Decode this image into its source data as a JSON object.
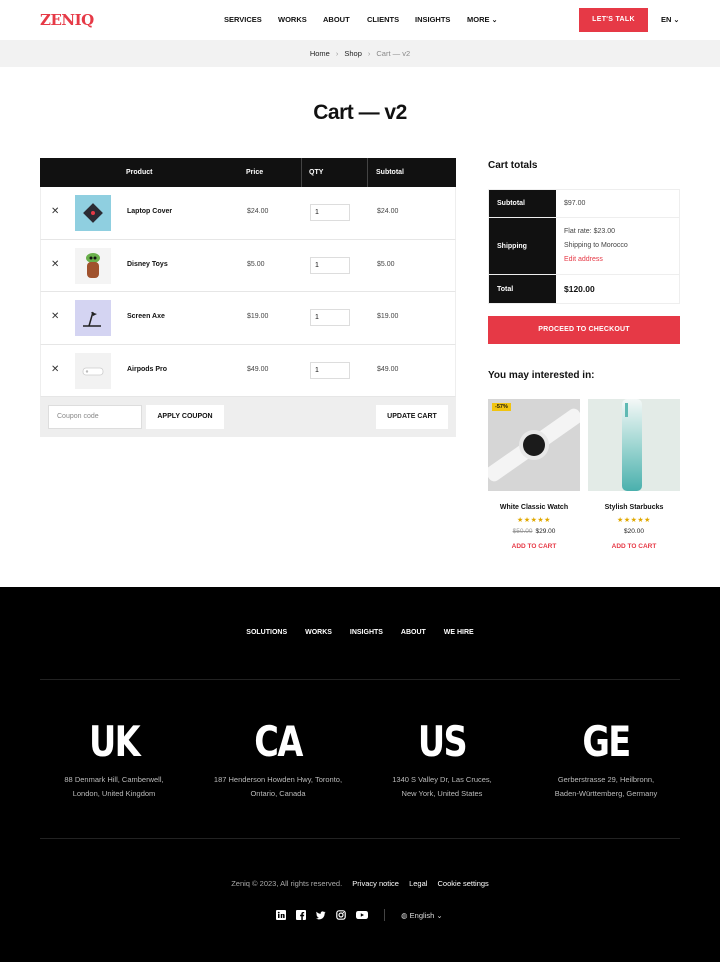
{
  "header": {
    "logo": "ZENIQ",
    "nav": [
      "SERVICES",
      "WORKS",
      "ABOUT",
      "CLIENTS",
      "INSIGHTS",
      "MORE"
    ],
    "cta": "LET'S TALK",
    "language": "EN"
  },
  "breadcrumb": [
    "Home",
    "Shop",
    "Cart — v2"
  ],
  "page_title": "Cart — v2",
  "cart": {
    "columns": [
      "Product",
      "Price",
      "QTY",
      "Subtotal"
    ],
    "rows": [
      {
        "name": "Laptop Cover",
        "price": "$24.00",
        "qty": "1",
        "subtotal": "$24.00"
      },
      {
        "name": "Disney Toys",
        "price": "$5.00",
        "qty": "1",
        "subtotal": "$5.00"
      },
      {
        "name": "Screen Axe",
        "price": "$19.00",
        "qty": "1",
        "subtotal": "$19.00"
      },
      {
        "name": "Airpods Pro",
        "price": "$49.00",
        "qty": "1",
        "subtotal": "$49.00"
      }
    ],
    "coupon_placeholder": "Coupon code",
    "apply_coupon": "APPLY COUPON",
    "update_cart": "UPDATE CART"
  },
  "totals": {
    "title": "Cart totals",
    "subtotal_label": "Subtotal",
    "subtotal": "$97.00",
    "shipping_label": "Shipping",
    "shipping_rate": "Flat rate: $23.00",
    "shipping_to": "Shipping to Morocco",
    "edit_address": "Edit address",
    "total_label": "Total",
    "total": "$120.00",
    "checkout": "PROCEED TO CHECKOUT"
  },
  "recommended": {
    "title": "You may interested in:",
    "items": [
      {
        "name": "White Classic Watch",
        "stars": "★★★★★",
        "old_price": "$50.00",
        "price": "$29.00",
        "badge": "-57%",
        "add": "ADD TO CART"
      },
      {
        "name": "Stylish Starbucks",
        "stars": "★★★★★",
        "price": "$20.00",
        "add": "ADD TO CART"
      }
    ]
  },
  "footer": {
    "nav": [
      "SOLUTIONS",
      "WORKS",
      "INSIGHTS",
      "ABOUT",
      "WE HIRE"
    ],
    "offices": [
      {
        "code": "UK",
        "line1": "88 Denmark Hill, Camberwell,",
        "line2": "London, United Kingdom"
      },
      {
        "code": "CA",
        "line1": "187 Henderson Howden Hwy, Toronto,",
        "line2": "Ontario, Canada"
      },
      {
        "code": "US",
        "line1": "1340 S Valley Dr, Las Cruces,",
        "line2": "New York, United States"
      },
      {
        "code": "GE",
        "line1": "Gerberstrasse 29, Heilbronn,",
        "line2": "Baden-Württemberg, Germany"
      }
    ],
    "copyright": "Zeniq © 2023, All rights reserved.",
    "links": [
      "Privacy notice",
      "Legal",
      "Cookie settings"
    ],
    "language": "English"
  },
  "colors": {
    "accent": "#e63946",
    "dark": "#111111"
  }
}
